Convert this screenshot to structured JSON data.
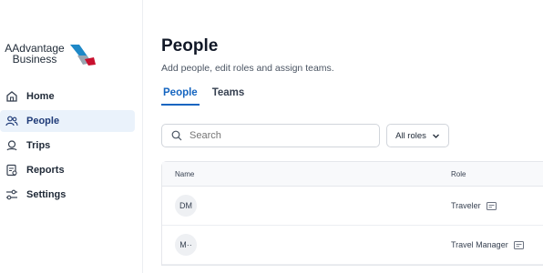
{
  "brand": {
    "line1": "AAdvantage",
    "line2": "Business"
  },
  "sidebar": {
    "items": [
      {
        "label": "Home",
        "icon": "home-icon"
      },
      {
        "label": "People",
        "icon": "people-icon",
        "active": true
      },
      {
        "label": "Trips",
        "icon": "trips-icon"
      },
      {
        "label": "Reports",
        "icon": "reports-icon"
      },
      {
        "label": "Settings",
        "icon": "settings-icon"
      }
    ]
  },
  "page": {
    "title": "People",
    "subtitle": "Add people, edit roles and assign teams."
  },
  "tabs": [
    {
      "label": "People",
      "active": true
    },
    {
      "label": "Teams"
    }
  ],
  "search": {
    "placeholder": "Search"
  },
  "filters": {
    "roles_label": "All roles"
  },
  "table": {
    "headers": {
      "name": "Name",
      "role": "Role"
    },
    "rows": [
      {
        "initials": "DM",
        "role": "Traveler"
      },
      {
        "initials": "M··",
        "role": "Travel Manager"
      }
    ]
  },
  "colors": {
    "accent": "#1565c0",
    "active_nav_bg": "#eaf2fb"
  }
}
